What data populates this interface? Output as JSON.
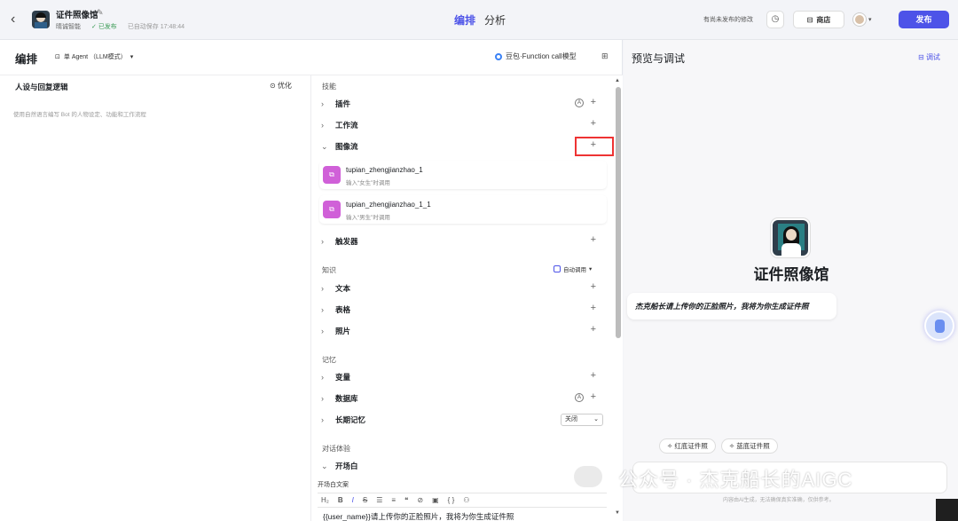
{
  "header": {
    "bot_title": "证件照像馆",
    "org": "晴诚智能",
    "status": "已发布",
    "autosave": "已自动保存 17:48:44",
    "tabs": [
      "编排",
      "分析"
    ],
    "unpublished_note": "有尚未发布的修改",
    "store_label": "商店",
    "publish_label": "发布",
    "accent": "#4d53e8"
  },
  "editor": {
    "title": "编排",
    "mode": "单 Agent （LLM模式）",
    "model": "豆包·Function call模型"
  },
  "persona": {
    "title": "人设与回复逻辑",
    "optimize": "优化",
    "placeholder": "使用自然语言编写 Bot 的人物设定、功能和工作流程"
  },
  "skills": {
    "section_skills": "技能",
    "plugins": "插件",
    "workflow": "工作流",
    "imageflow": "图像流",
    "cards": [
      {
        "name": "tupian_zhengjianzhao_1",
        "desc": "输入“女生”时调用"
      },
      {
        "name": "tupian_zhengjianzhao_1_1",
        "desc": "输入“男生”时调用"
      }
    ],
    "trigger": "触发器",
    "section_knowledge": "知识",
    "auto_call": "自动调用",
    "text": "文本",
    "table": "表格",
    "photo": "照片",
    "section_memory": "记忆",
    "variable": "变量",
    "database": "数据库",
    "long_memory": "长期记忆",
    "long_memory_value": "关闭",
    "section_dialog": "对话体验",
    "opener": "开场白",
    "opener_text_label": "开场白文案",
    "opener_text": "{{user_name}}请上传你的正脸照片，我将为你生成证件照"
  },
  "preview": {
    "title": "预览与调试",
    "debug": "调试",
    "bot_name": "证件照像馆",
    "greeting": "杰克船长请上传你的正脸照片，我将为你生成证件照",
    "chips": [
      "红底证件照",
      "蓝底证件照"
    ],
    "disclaimer": "内容由AI生成，无法确保真实准确，仅供参考。",
    "watermark": "公众号 · 杰克船长的AIGC"
  }
}
